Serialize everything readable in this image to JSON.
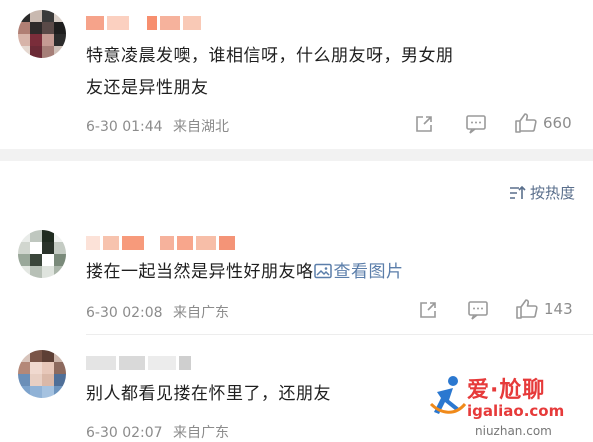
{
  "comments": [
    {
      "text": "特意凌晨发噢，谁相信呀，什么朋友呀，男女朋友还是异性朋友",
      "text_line1": "特意凌晨发噢，谁相信呀，什么朋友呀，男女朋",
      "text_line2": "友还是异性朋友",
      "time": "6-30 01:44",
      "location": "来自湖北",
      "likes": "660"
    },
    {
      "text": "搂在一起当然是异性好朋友咯",
      "view_image_label": "查看图片",
      "time": "6-30 02:08",
      "location": "来自广东",
      "likes": "143"
    },
    {
      "text": "别人都看见搂在怀里了，还朋友",
      "time": "6-30 02:07",
      "location": "来自广东",
      "likes": ""
    }
  ],
  "sort": {
    "label": "按热度"
  },
  "watermark": {
    "title": "爱·尬聊",
    "url": "igaliao.com",
    "url2": "niuzhan.com"
  },
  "icons": {
    "share": "share-icon",
    "comment": "comment-icon",
    "like": "thumbs-up-icon",
    "sort": "sort-icon",
    "image": "image-icon"
  },
  "colors": {
    "text": "#1f1f1f",
    "meta": "#8c8c8c",
    "link": "#5b7eaa",
    "divider_band": "#f2f2f2",
    "watermark": "#e63a3a"
  }
}
